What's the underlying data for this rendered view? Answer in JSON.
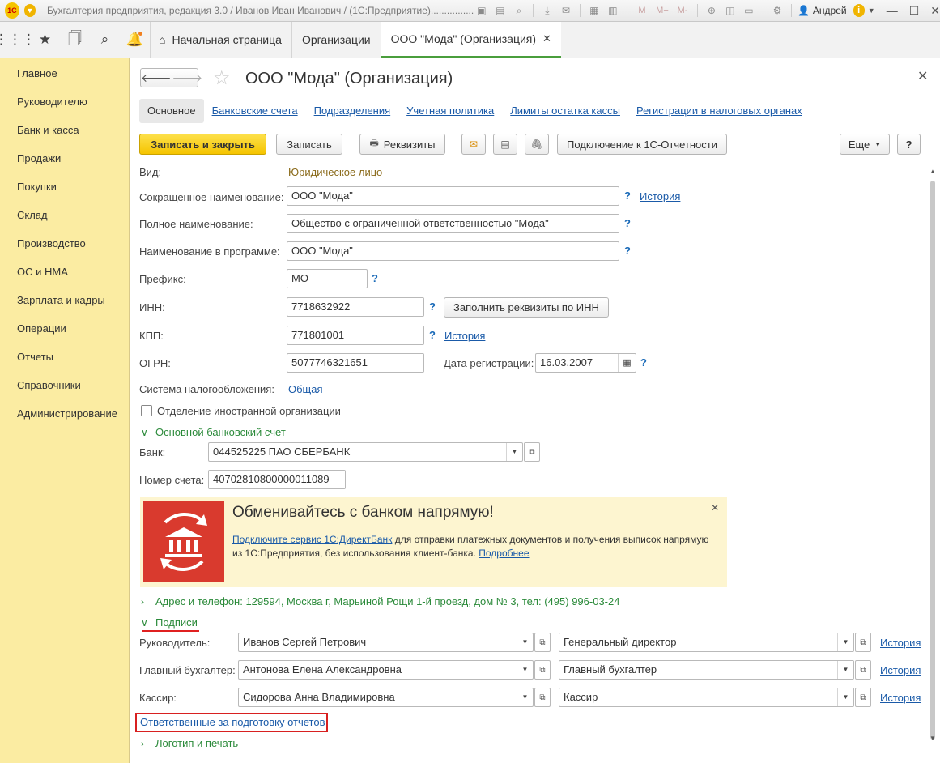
{
  "app": {
    "title": "Бухгалтерия предприятия, редакция 3.0 / Иванов Иван Иванович / (1С:Предприятие)..................... (1С:Предприятие)",
    "user": "Андрей",
    "toolbar_m_labels": [
      "M",
      "M+",
      "M-"
    ]
  },
  "topnav": {
    "tabs": [
      {
        "label": "Начальная страница"
      },
      {
        "label": "Организации"
      },
      {
        "label": "ООО \"Мода\" (Организация)"
      }
    ]
  },
  "sidebar": {
    "items": [
      {
        "label": "Главное"
      },
      {
        "label": "Руководителю"
      },
      {
        "label": "Банк и касса"
      },
      {
        "label": "Продажи"
      },
      {
        "label": "Покупки"
      },
      {
        "label": "Склад"
      },
      {
        "label": "Производство"
      },
      {
        "label": "ОС и НМА"
      },
      {
        "label": "Зарплата и кадры"
      },
      {
        "label": "Операции"
      },
      {
        "label": "Отчеты"
      },
      {
        "label": "Справочники"
      },
      {
        "label": "Администрирование"
      }
    ]
  },
  "form": {
    "title": "ООО \"Мода\" (Организация)",
    "subtabs": [
      {
        "label": "Основное"
      },
      {
        "label": "Банковские счета"
      },
      {
        "label": "Подразделения"
      },
      {
        "label": "Учетная политика"
      },
      {
        "label": "Лимиты остатка кассы"
      },
      {
        "label": "Регистрации в налоговых органах"
      }
    ],
    "buttons": {
      "save_close": "Записать и закрыть",
      "save": "Записать",
      "details": "Реквизиты",
      "connect": "Подключение к 1С-Отчетности",
      "more": "Еще",
      "help": "?"
    },
    "fields": {
      "kind_label": "Вид:",
      "kind_value": "Юридическое лицо",
      "short_name_label": "Сокращенное наименование:",
      "short_name": "ООО \"Мода\"",
      "history": "История",
      "full_name_label": "Полное наименование:",
      "full_name": "Общество с ограниченной ответственностью \"Мода\"",
      "prog_name_label": "Наименование в программе:",
      "prog_name": "ООО \"Мода\"",
      "prefix_label": "Префикс:",
      "prefix": "МО",
      "inn_label": "ИНН:",
      "inn": "7718632922",
      "fill_by_inn": "Заполнить реквизиты по ИНН",
      "kpp_label": "КПП:",
      "kpp": "771801001",
      "ogrn_label": "ОГРН:",
      "ogrn": "5077746321651",
      "reg_date_label": "Дата регистрации:",
      "reg_date": "16.03.2007",
      "tax_label": "Система налогообложения:",
      "tax_value": "Общая",
      "foreign_label": "Отделение иностранной организации",
      "q": "?"
    },
    "bank": {
      "group": "Основной банковский счет",
      "bank_label": "Банк:",
      "bank_value": "044525225 ПАО СБЕРБАНК",
      "account_label": "Номер счета:",
      "account_value": "40702810800000011089"
    },
    "banner": {
      "title": "Обменивайтесь с банком напрямую!",
      "link": "Подключите сервис 1С:ДиректБанк",
      "text": " для отправки платежных документов и получения выписок напрямую из 1С:Предприятия, без использования клиент-банка. ",
      "more": "Подробнее"
    },
    "address_group": "Адрес и телефон: 129594, Москва г, Марьиной Рощи 1-й проезд, дом № 3, тел: (495) 996-03-24",
    "signatures": {
      "group": "Подписи",
      "rows": [
        {
          "label": "Руководитель:",
          "person": "Иванов Сергей Петрович",
          "position": "Генеральный директор",
          "history": "История"
        },
        {
          "label": "Главный бухгалтер:",
          "person": "Антонова Елена Александровна",
          "position": "Главный бухгалтер",
          "history": "История"
        },
        {
          "label": "Кассир:",
          "person": "Сидорова Анна Владимировна",
          "position": "Кассир",
          "history": "История"
        }
      ],
      "responsible_link": "Ответственные за подготовку отчетов"
    },
    "logo_group": "Логотип и печать"
  }
}
